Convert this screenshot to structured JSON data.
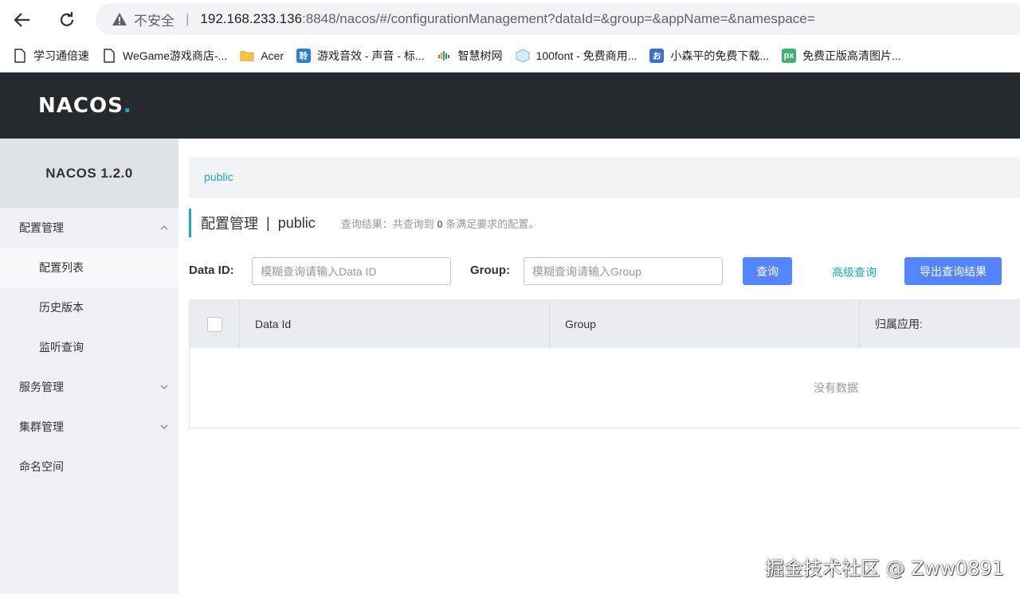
{
  "browser": {
    "security_label": "不安全",
    "url_host": "192.168.233.136",
    "url_rest": ":8848/nacos/#/configurationManagement?dataId=&group=&appName=&namespace="
  },
  "bookmarks": [
    {
      "label": "学习通倍速",
      "icon": "page-icon"
    },
    {
      "label": "WeGame游戏商店-...",
      "icon": "page-icon"
    },
    {
      "label": "Acer",
      "icon": "folder-icon"
    },
    {
      "label": "游戏音效 - 声音 - 标...",
      "icon": "sound-site-icon"
    },
    {
      "label": "智慧树网",
      "icon": "zhihuishu-icon"
    },
    {
      "label": "100font - 免费商用...",
      "icon": "cube-icon"
    },
    {
      "label": "小森平的免费下载...",
      "icon": "o-site-icon"
    },
    {
      "label": "免费正版高清图片...",
      "icon": "px-icon"
    }
  ],
  "app": {
    "logo_text": "NACOS",
    "version": "NACOS 1.2.0"
  },
  "sidebar": {
    "items": [
      {
        "label": "配置管理",
        "expanded": true
      },
      {
        "label": "配置列表",
        "sub": true,
        "active": true
      },
      {
        "label": "历史版本",
        "sub": true
      },
      {
        "label": "监听查询",
        "sub": true
      },
      {
        "label": "服务管理",
        "expanded": false
      },
      {
        "label": "集群管理",
        "expanded": false
      },
      {
        "label": "命名空间"
      }
    ]
  },
  "main": {
    "namespace_tab": "public",
    "title": "配置管理",
    "title_sep": "|",
    "namespace": "public",
    "hint_prefix": "查询结果：共查询到",
    "hint_count": "0",
    "hint_suffix": "条满足要求的配置。",
    "dataid_label": "Data ID:",
    "dataid_placeholder": "模糊查询请输入Data ID",
    "group_label": "Group:",
    "group_placeholder": "模糊查询请输入Group",
    "query_button": "查询",
    "advanced_link": "高级查询",
    "export_button": "导出查询结果",
    "columns": [
      "Data Id",
      "Group",
      "归属应用:"
    ],
    "empty_text": "没有数据"
  },
  "watermark": "掘金技术社区 @ Zww0891",
  "colors": {
    "header_bg": "#252a2f",
    "accent": "#1ba7c7",
    "primary_button": "#5584ff",
    "sidebar_bg": "#eef0f3"
  }
}
